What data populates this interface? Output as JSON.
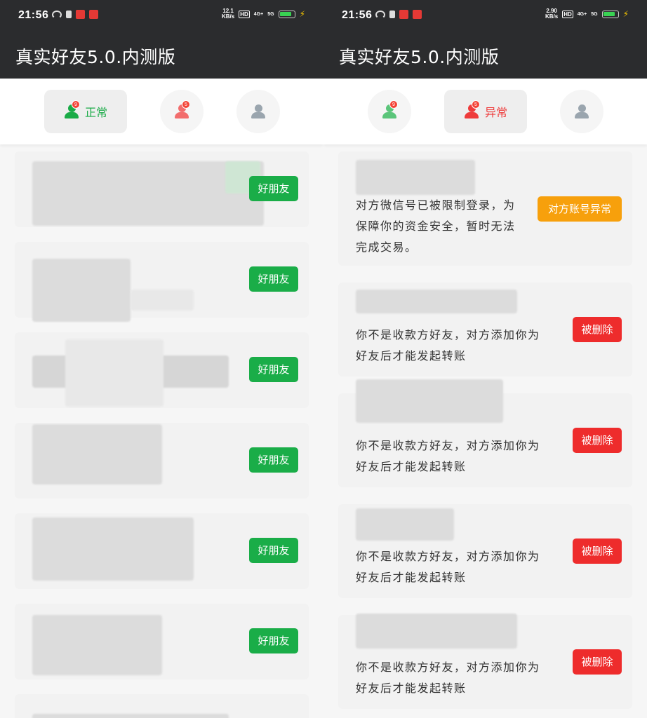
{
  "status_bar": {
    "time": "21:56",
    "left_speed": "12.1",
    "right_speed": "2.90",
    "speed_unit": "KB/s",
    "hd": "HD",
    "net_4g": "4G+",
    "net_5g": "5G"
  },
  "app_title": "真实好友5.0.内测版",
  "tabs": {
    "normal": {
      "label": "正常",
      "badge": "9",
      "color": "#1aab47"
    },
    "abnormal": {
      "label": "异常",
      "badge": "5",
      "color": "#ee3b3b"
    }
  },
  "left_screen": {
    "cards": [
      {
        "button": "好朋友"
      },
      {
        "button": "好朋友"
      },
      {
        "button": "好朋友"
      },
      {
        "button": "好朋友"
      },
      {
        "button": "好朋友"
      },
      {
        "button": "好朋友"
      }
    ]
  },
  "right_screen": {
    "cards": [
      {
        "line1": "对方微信号已被限制登录，为",
        "line2": "保障你的资金安全，暂时无法",
        "line3": "完成交易。",
        "button": "对方账号异常"
      },
      {
        "line1": "你不是收款方好友，对方添加你为",
        "line2": "好友后才能发起转账",
        "button": "被删除"
      },
      {
        "line1": "你不是收款方好友，对方添加你为",
        "line2": "好友后才能发起转账",
        "button": "被删除"
      },
      {
        "line1": "你不是收款方好友，对方添加你为",
        "line2": "好友后才能发起转账",
        "button": "被删除"
      },
      {
        "line1": "你不是收款方好友，对方添加你为",
        "line2": "好友后才能发起转账",
        "button": "被删除"
      }
    ]
  },
  "colors": {
    "friend_button": "#1aad48",
    "deleted_button": "#ee2c2c",
    "abnormal_button": "#f7a00c",
    "header": "#2b2c2e"
  }
}
